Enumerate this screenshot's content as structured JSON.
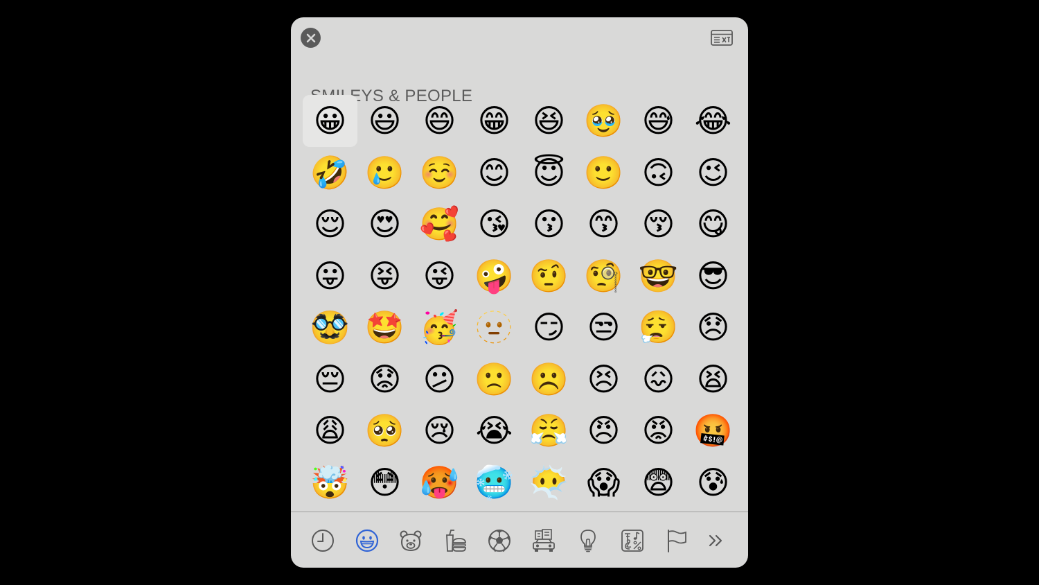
{
  "colors": {
    "panel": "#d9d9d8",
    "icon": "#595959",
    "active": "#2f63d6"
  },
  "section_title": "SMILEYS & PEOPLE",
  "emoji_rows": [
    [
      "😀",
      "😃",
      "😄",
      "😁",
      "😆",
      "🥹",
      "😅",
      "😂"
    ],
    [
      "🤣",
      "🥲",
      "☺️",
      "😊",
      "😇",
      "🙂",
      "🙃",
      "😉"
    ],
    [
      "😌",
      "😍",
      "🥰",
      "😘",
      "😗",
      "😙",
      "😚",
      "😋"
    ],
    [
      "😛",
      "😝",
      "😜",
      "🤪",
      "🤨",
      "🧐",
      "🤓",
      "😎"
    ],
    [
      "🥸",
      "🤩",
      "🥳",
      "🫥",
      "😏",
      "😒",
      "😮‍💨",
      "😞"
    ],
    [
      "😔",
      "😟",
      "😕",
      "🙁",
      "☹️",
      "😣",
      "😖",
      "😫"
    ],
    [
      "😩",
      "🥺",
      "😢",
      "😭",
      "😤",
      "😠",
      "😡",
      "🤬"
    ],
    [
      "🤯",
      "😳",
      "🥵",
      "🥶",
      "😶‍🌫️",
      "😱",
      "😨",
      "😰"
    ]
  ],
  "selected_index": 0,
  "tabs": [
    {
      "icon": "clock-icon",
      "active": false
    },
    {
      "icon": "smiley-icon",
      "active": true
    },
    {
      "icon": "bear-icon",
      "active": false
    },
    {
      "icon": "food-icon",
      "active": false
    },
    {
      "icon": "soccer-ball-icon",
      "active": false
    },
    {
      "icon": "travel-car-icon",
      "active": false
    },
    {
      "icon": "lightbulb-icon",
      "active": false
    },
    {
      "icon": "symbols-icon",
      "active": false
    },
    {
      "icon": "flag-icon",
      "active": false
    },
    {
      "icon": "more-chevron-icon",
      "active": false
    }
  ]
}
